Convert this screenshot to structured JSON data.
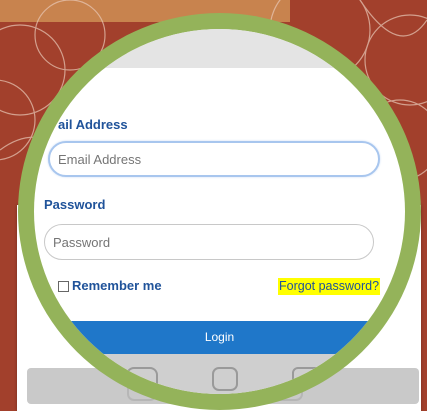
{
  "form": {
    "email_label": "ail Address",
    "email_placeholder": "Email Address",
    "password_label": "Password",
    "password_placeholder": "Password",
    "remember_label": "Remember me",
    "forgot_label": "Forgot password?",
    "login_label": "Login"
  },
  "social": {
    "icons": [
      "facebook-icon",
      "instagram-icon",
      "youtube-icon"
    ]
  },
  "colors": {
    "background": "#a2402c",
    "accent_band": "#c8834e",
    "magnifier_ring": "#94b35a",
    "label_text": "#20539a",
    "login_button": "#1f77c9",
    "highlight": "#ffff00"
  }
}
